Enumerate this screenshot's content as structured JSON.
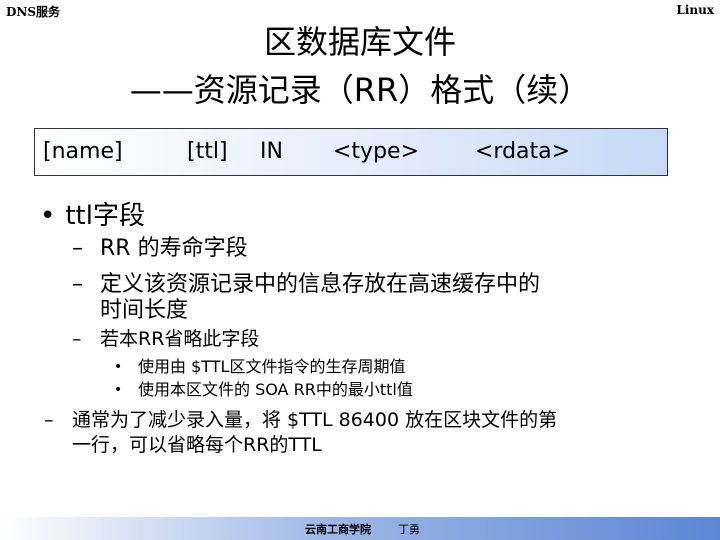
{
  "header": {
    "left": "DNS服务",
    "right": "Linux"
  },
  "title": {
    "line1": "区数据库文件",
    "line2": "——资源记录（RR）格式（续）"
  },
  "rr_format": {
    "name": "[name]",
    "ttl": "[ttl]",
    "class": "IN",
    "type": "<type>",
    "rdata": "<rdata>"
  },
  "bullet": "ttl字段",
  "items": [
    "RR 的寿命字段",
    "定义该资源记录中的信息存放在高速缓存中的",
    "时间长度",
    "若本RR省略此字段"
  ],
  "subitems": [
    "使用由 $TTL区文件指令的生存周期值",
    "使用本区文件的 SOA RR中的最小ttl值"
  ],
  "last_item": [
    "通常为了减少录入量，将 $TTL 86400 放在区块文件的第",
    "一行，可以省略每个RR的TTL"
  ],
  "footer": {
    "school": "云南工商学院",
    "author": "丁勇"
  }
}
